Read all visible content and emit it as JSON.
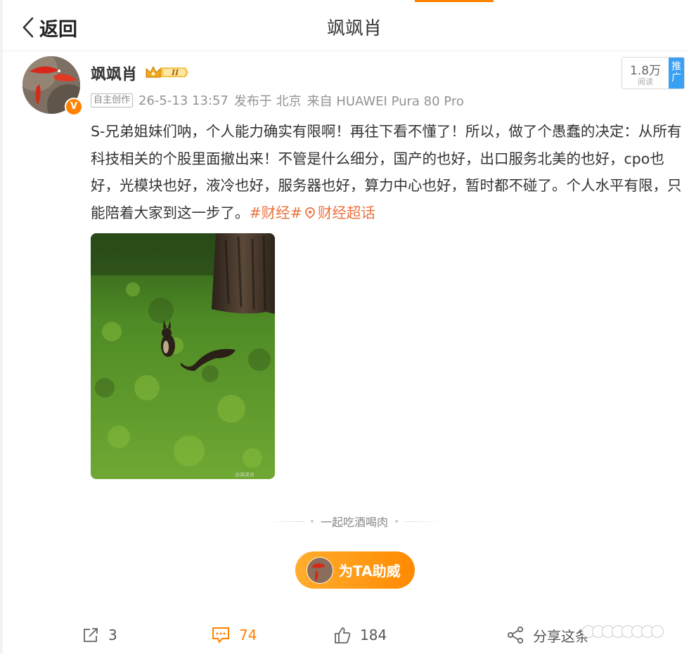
{
  "header": {
    "back_label": "返回",
    "title": "飒飒肖"
  },
  "post": {
    "author": "飒飒肖",
    "vip_level": "II",
    "verified_badge": "V",
    "original_tag": "自主创作",
    "time": "26-5-13 13:57",
    "location": "发布于 北京",
    "source": "来自 HUAWEI Pura 80 Pro",
    "reads": {
      "count": "1.8万",
      "label": "阅读",
      "promote": "推广"
    },
    "text": "S-兄弟姐妹们呐，个人能力确实有限啊！再往下看不懂了！所以，做了个愚蠢的决定：从所有科技相关的个股里面撤出来！不管是什么细分，国产的也好，出口服务北美的也好，cpo也好，光模块也好，液冷也好，服务器也好，算力中心也好，暂时都不碰了。个人水平有限，只能陪着大家到这一步了。",
    "hashtag": "#财经#",
    "supertopic": "财经超话",
    "image_watermark": "@飒飒肖"
  },
  "footer": {
    "divider_text": "一起吃酒喝肉",
    "cheer_label": "为TA助威"
  },
  "actions": {
    "repost_count": "3",
    "comment_count": "74",
    "like_count": "184",
    "share_label": "分享这条"
  },
  "colors": {
    "accent": "#ff8200",
    "hashtag": "#eb7340",
    "promote": "#3aa0f3"
  },
  "icons": [
    "chevron-left-icon",
    "crown-icon",
    "verified-icon",
    "repost-icon",
    "comment-icon",
    "like-icon",
    "share-icon",
    "supertopic-icon"
  ]
}
